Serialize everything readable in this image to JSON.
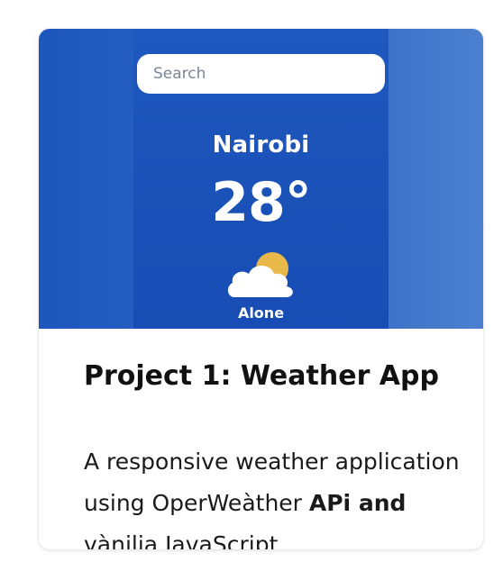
{
  "search": {
    "placeholder": "Search"
  },
  "weather": {
    "city": "Nairobi",
    "temperature": "28°",
    "condition": "Alone",
    "icon": "partly-cloudy-icon"
  },
  "project": {
    "title": "Project 1: Weather App",
    "description_line1": "A responsive weather application",
    "description_line2_pre": "using OperWeàther ",
    "description_line2_strong": "APi and",
    "description_line3": "vànilia JavaScript"
  },
  "colors": {
    "hero_blue": "#2a62c2",
    "phone_blue": "#1f58be",
    "sun_yellow": "#e8b84a"
  }
}
